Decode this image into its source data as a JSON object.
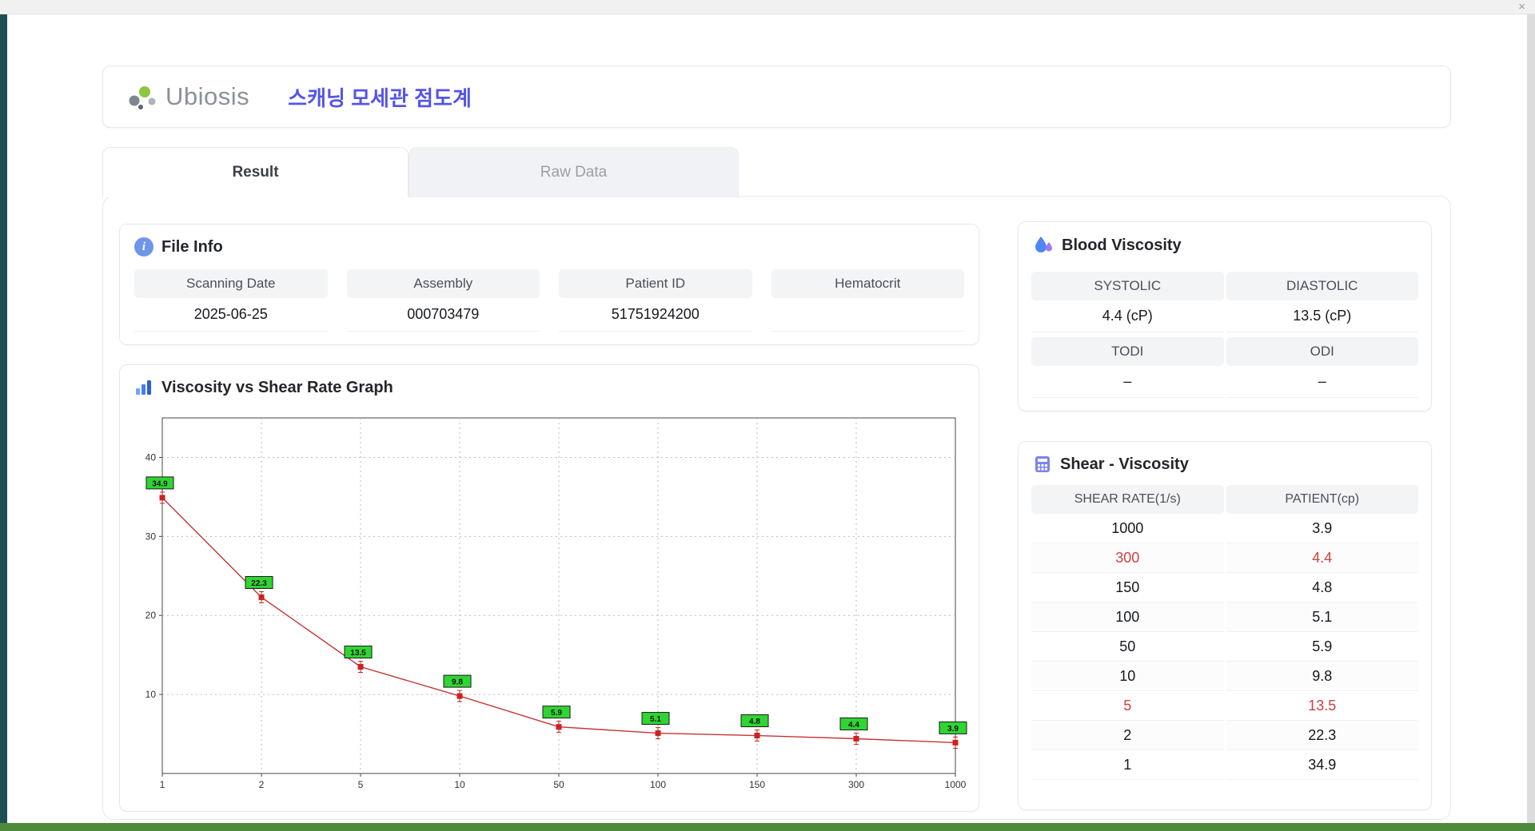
{
  "window": {
    "close_label": "×"
  },
  "header": {
    "logo_text": "Ubiosis",
    "title": "스캐닝 모세관 점도계"
  },
  "tabs": [
    {
      "label": "Result",
      "active": true
    },
    {
      "label": "Raw Data",
      "active": false
    }
  ],
  "file_info": {
    "title": "File Info",
    "fields": [
      {
        "label": "Scanning Date",
        "value": "2025-06-25"
      },
      {
        "label": "Assembly",
        "value": "000703479"
      },
      {
        "label": "Patient ID",
        "value": "51751924200"
      },
      {
        "label": "Hematocrit",
        "value": ""
      }
    ]
  },
  "blood_viscosity": {
    "title": "Blood Viscosity",
    "rows": [
      {
        "labels": [
          "SYSTOLIC",
          "DIASTOLIC"
        ],
        "values": [
          "4.4 (cP)",
          "13.5 (cP)"
        ]
      },
      {
        "labels": [
          "TODI",
          "ODI"
        ],
        "values": [
          "–",
          "–"
        ]
      }
    ]
  },
  "graph": {
    "title": "Viscosity vs Shear Rate Graph"
  },
  "chart_data": {
    "type": "line",
    "title": "Viscosity vs Shear Rate Graph",
    "x": [
      "1",
      "2",
      "5",
      "10",
      "50",
      "100",
      "150",
      "300",
      "1000"
    ],
    "values": [
      34.9,
      22.3,
      13.5,
      9.8,
      5.9,
      5.1,
      4.8,
      4.4,
      3.9
    ],
    "point_labels": [
      "34.9",
      "22.3",
      "13.5",
      "9.8",
      "5.9",
      "5.1",
      "4.8",
      "4.4",
      "3.9"
    ],
    "xlabel": "",
    "ylabel": "",
    "x_axis_type": "category",
    "yticks": [
      10,
      20,
      30,
      40
    ],
    "ylim": [
      0,
      45
    ],
    "grid": "dashed",
    "legend": "none",
    "line_color": "#c43434",
    "marker_color": "#cc2222",
    "label_bg": "#2fd532"
  },
  "shear_table": {
    "title": "Shear - Viscosity",
    "columns": [
      "SHEAR RATE(1/s)",
      "PATIENT(cp)"
    ],
    "rows": [
      {
        "shear": "1000",
        "patient": "3.9",
        "highlight": false
      },
      {
        "shear": "300",
        "patient": "4.4",
        "highlight": true
      },
      {
        "shear": "150",
        "patient": "4.8",
        "highlight": false
      },
      {
        "shear": "100",
        "patient": "5.1",
        "highlight": false
      },
      {
        "shear": "50",
        "patient": "5.9",
        "highlight": false
      },
      {
        "shear": "10",
        "patient": "9.8",
        "highlight": false
      },
      {
        "shear": "5",
        "patient": "13.5",
        "highlight": true
      },
      {
        "shear": "2",
        "patient": "22.3",
        "highlight": false
      },
      {
        "shear": "1",
        "patient": "34.9",
        "highlight": false
      }
    ]
  },
  "colors": {
    "accent_title": "#5554e8",
    "highlight_red": "#d24040",
    "header_cell_bg": "#f3f4f6",
    "chart_line": "#c43434",
    "chart_label_bg": "#2fd532"
  }
}
